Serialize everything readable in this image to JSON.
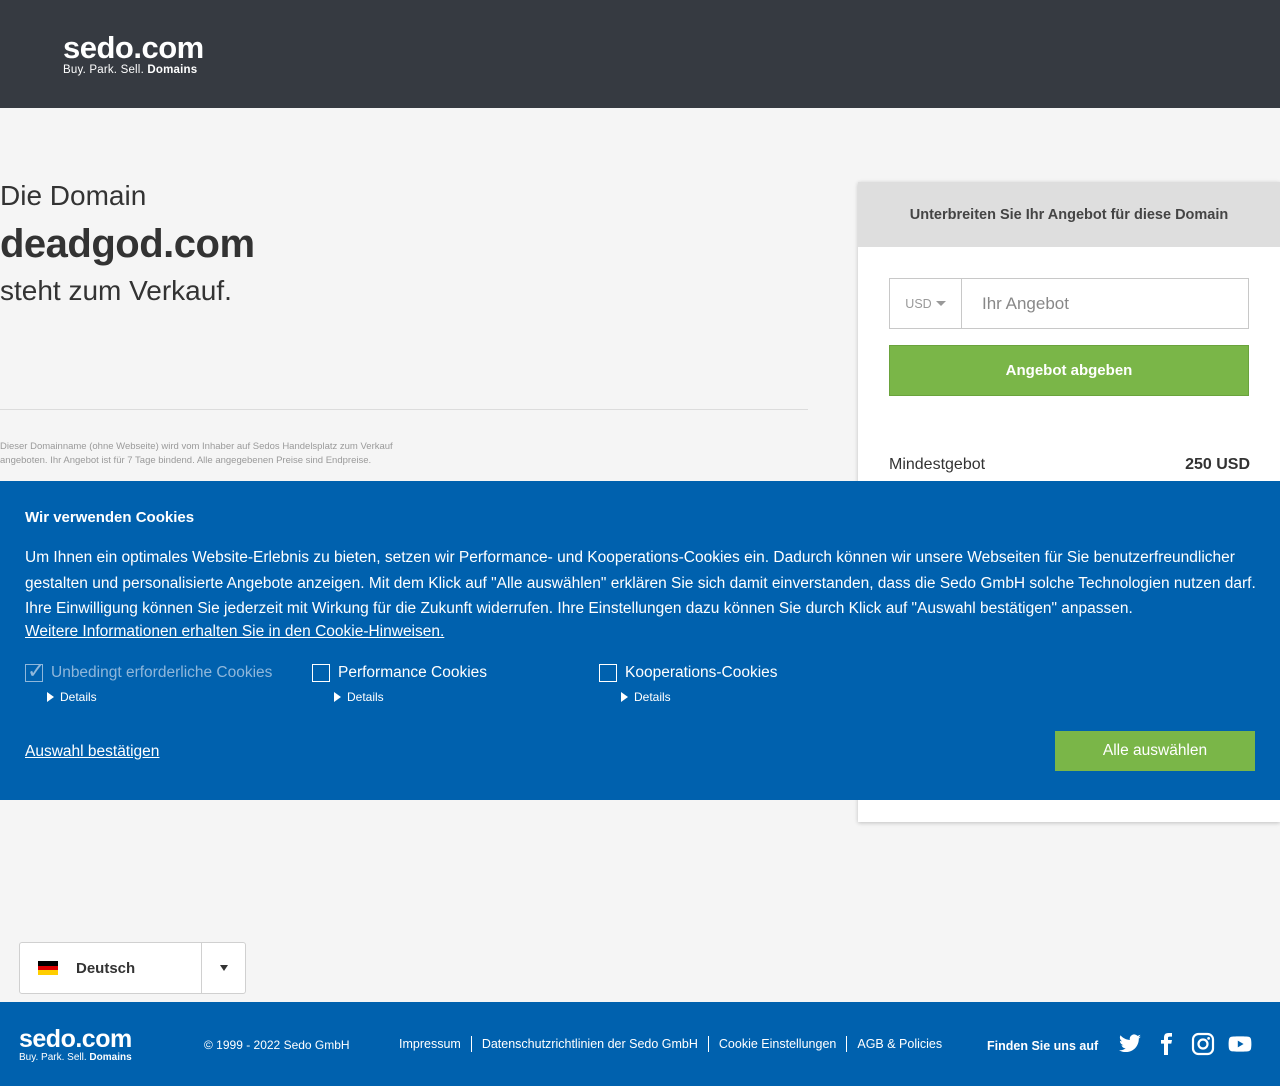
{
  "header": {
    "logo_main": "sedo.com",
    "logo_tagline": "Buy.  Park.  Sell. ",
    "logo_tagline_bold": "Domains"
  },
  "hero": {
    "line1": "Die Domain",
    "domain": "deadgod.com",
    "line3": "steht zum Verkauf."
  },
  "disclaimer": "Dieser Domainname (ohne Webseite) wird vom Inhaber auf Sedos Handelsplatz zum Verkauf angeboten. Ihr Angebot ist für 7 Tage bindend. Alle angegebenen Preise sind Endpreise.",
  "offer": {
    "title": "Unterbreiten Sie Ihr Angebot für diese Domain",
    "currency": "USD",
    "placeholder": "Ihr Angebot",
    "submit_label": "Angebot abgeben",
    "min_label": "Mindestgebot",
    "min_value": "250 USD"
  },
  "cookie": {
    "title": "Wir verwenden Cookies",
    "text": "Um Ihnen ein optimales Website-Erlebnis zu bieten, setzen wir Performance- und Kooperations-Cookies ein. Dadurch können wir unsere Webseiten für Sie benutzerfreundlicher gestalten und personalisierte Angebote anzeigen. Mit dem Klick auf \"Alle auswählen\" erklären Sie sich damit einverstanden, dass die Sedo GmbH solche Technologien nutzen darf. Ihre Einwilligung können Sie jederzeit mit Wirkung für die Zukunft widerrufen. Ihre Einstellungen dazu können Sie durch Klick auf \"Auswahl bestätigen\" anpassen.",
    "more_link": "Weitere Informationen erhalten Sie in den Cookie-Hinweisen.",
    "options": [
      {
        "label": "Unbedingt erforderliche Cookies",
        "details": "Details",
        "checked": true,
        "disabled": true
      },
      {
        "label": "Performance Cookies",
        "details": "Details",
        "checked": false
      },
      {
        "label": "Kooperations-Cookies",
        "details": "Details",
        "checked": false
      }
    ],
    "confirm_label": "Auswahl bestätigen",
    "select_all_label": "Alle auswählen"
  },
  "language": {
    "selected": "Deutsch",
    "flag_colors": [
      "#000000",
      "#dd0000",
      "#ffce00"
    ]
  },
  "footer": {
    "logo_main": "sedo.com",
    "logo_tagline": "Buy.  Park.  Sell. ",
    "logo_tagline_bold": "Domains",
    "copyright": "© 1999 - 2022 Sedo GmbH",
    "links": [
      "Impressum",
      "Datenschutzrichtlinien der Sedo GmbH",
      "Cookie Einstellungen",
      "AGB & Policies"
    ],
    "find_us": "Finden Sie uns auf",
    "social_icons": [
      "twitter-icon",
      "facebook-icon",
      "instagram-icon",
      "youtube-icon"
    ]
  },
  "colors": {
    "header_bg": "#363a41",
    "brand_blue": "#0061ae",
    "accent_green": "#7ab648"
  }
}
